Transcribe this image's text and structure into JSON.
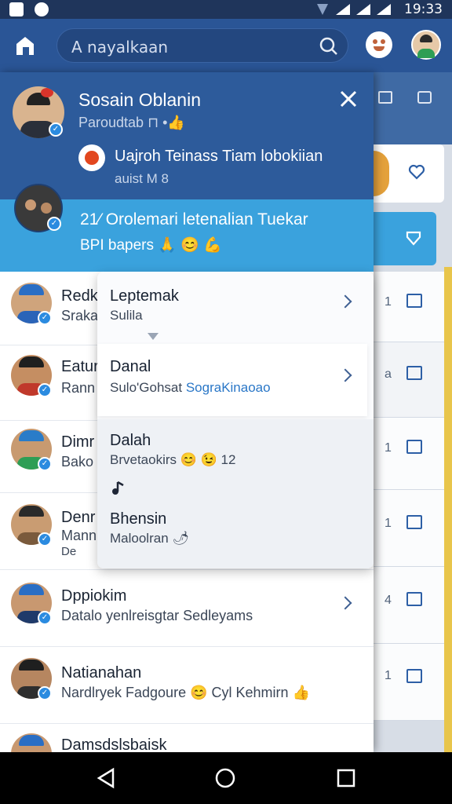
{
  "status_bar": {
    "time": "19:33"
  },
  "appbar": {
    "search_placeholder": "A nayalkaan"
  },
  "profile": {
    "name": "Sosain Oblanin",
    "subtitle": "Paroudtab ⊓ •👍",
    "account_line": "Uajroh Teinass Tiam lobokiian",
    "account_sub": "auist M  8"
  },
  "banner": {
    "line1": "21⁄ Orolemari letenalian Tuekar",
    "line2": "BPI bapers 🙏 😊 💪"
  },
  "list": [
    {
      "name": "Redki",
      "sub": "Sraka",
      "right_num": "1"
    },
    {
      "name": "Eatur",
      "sub": "Rann",
      "right_num": "a"
    },
    {
      "name": "Dimr",
      "sub": "Bako",
      "right_num": "1"
    },
    {
      "name": "Denr",
      "sub": "Mann",
      "sub2": "De",
      "right_num": "1"
    },
    {
      "name": "Dppiokim",
      "sub": "Datalo yenlreisgtar Sedleyams",
      "right_num": "4"
    },
    {
      "name": "Natianahan",
      "sub": "Nardlryek Fadgoure 😊 Cyl Kehmirn 👍",
      "right_num": "1"
    },
    {
      "name": "Damsdslsbaisk",
      "sub": "",
      "right_num": ""
    }
  ],
  "popup": {
    "items": [
      {
        "title": "Leptemak",
        "sub": "Sulila"
      },
      {
        "title": "Danal",
        "sub": "Sulo'Gohsat",
        "sub_link": "SograKinaoao"
      },
      {
        "title": "Dalah",
        "sub": "Brvetaokirs 😊 😉 12"
      },
      {
        "title": "Bhensin",
        "sub": "Maloolran 🌶"
      }
    ]
  },
  "colors": {
    "appbar": "#2a5596",
    "drawer_header": "#2d5b9b",
    "banner": "#3aa2dd",
    "accent": "#2b8be0",
    "link": "#2a77c7"
  },
  "icons": [
    "home-icon",
    "search-icon",
    "emoji-icon",
    "close-icon",
    "chevron-right-icon",
    "back-icon",
    "home-circle-icon",
    "recents-icon"
  ]
}
